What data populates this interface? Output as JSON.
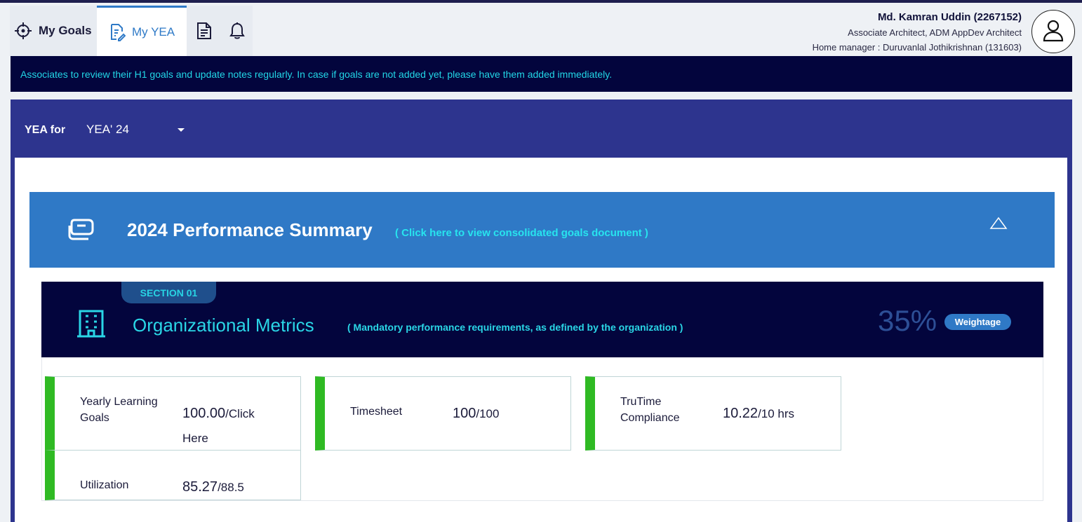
{
  "tabs": {
    "my_goals": "My Goals",
    "my_yea": "My YEA"
  },
  "user": {
    "name": "Md. Kamran Uddin (2267152)",
    "role": "Associate Architect, ADM AppDev Architect",
    "manager": "Home manager : Duruvanlal Jothikrishnan (131603)"
  },
  "notice": "Associates to review their H1 goals and update notes regularly. In case if goals are not added yet, please have them added immediately.",
  "yea": {
    "label": "YEA for",
    "selected": "YEA' 24"
  },
  "summary": {
    "title": "2024 Performance Summary",
    "link": "( Click here to view consolidated goals document )"
  },
  "section": {
    "badge": "SECTION 01",
    "title": "Organizational Metrics",
    "subtitle": "( Mandatory performance requirements, as defined by the organization )",
    "percent": "35%",
    "weightage": "Weightage"
  },
  "metrics": {
    "learning": {
      "label1": "Yearly Learning",
      "label2": "Goals",
      "value": "100.00",
      "suffix1": "/Click",
      "suffix2": "Here"
    },
    "timesheet": {
      "label": "Timesheet",
      "value": "100",
      "suffix": "/100"
    },
    "trutime": {
      "label1": "TruTime",
      "label2": "Compliance",
      "value": "10.22",
      "suffix": "/10 hrs"
    },
    "utilization": {
      "label": "Utilization",
      "value": "85.27",
      "suffix": "/88.5"
    }
  },
  "colors": {
    "navy": "#03053d",
    "panel": "#2d348e",
    "blue": "#2f79c6",
    "cyan": "#2ad6e6",
    "green": "#2fba23"
  }
}
